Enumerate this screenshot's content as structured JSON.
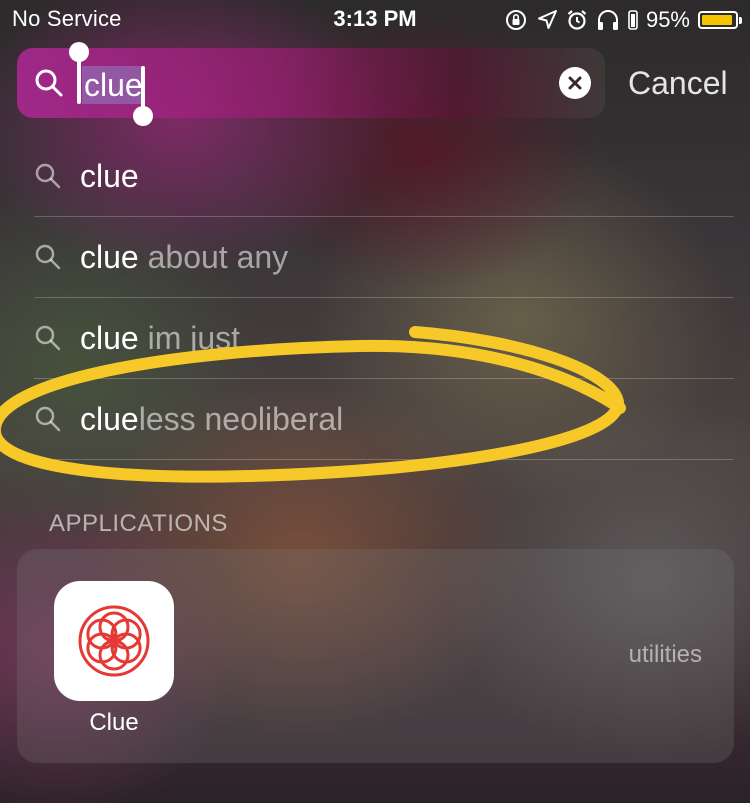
{
  "status_bar": {
    "carrier": "No Service",
    "time": "3:13 PM",
    "battery_percent": "95%",
    "battery_level": 0.95,
    "battery_color": "#f5c400",
    "icons": [
      "orientation-lock-icon",
      "location-arrow-icon",
      "alarm-icon",
      "headphones-icon",
      "battery-icon"
    ]
  },
  "search": {
    "query": "clue",
    "cancel_label": "Cancel",
    "icon": "search-icon",
    "clear_icon": "clear-icon"
  },
  "suggestions": [
    {
      "match": "clue",
      "rest": ""
    },
    {
      "match": "clue",
      "rest": " about any"
    },
    {
      "match": "clue",
      "rest": " im just"
    },
    {
      "match": "clue",
      "rest": "less neoliberal"
    }
  ],
  "annotation": {
    "color": "#f6c928",
    "target": "clueless neoliberal"
  },
  "applications": {
    "header": "APPLICATIONS",
    "items": [
      {
        "name": "Clue",
        "category": "utilities",
        "icon": "clue-app-icon",
        "icon_color": "#e53935"
      }
    ]
  }
}
